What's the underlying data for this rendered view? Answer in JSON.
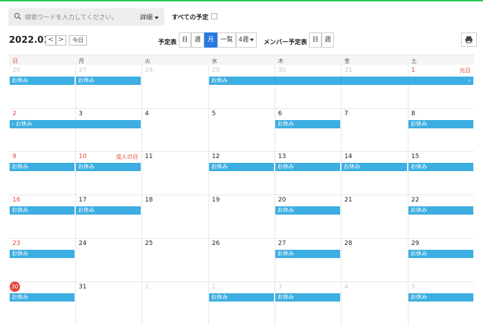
{
  "search": {
    "placeholder": "検索ワードを入力してください。",
    "detail_label": "詳細"
  },
  "all_schedules_label": "すべての予定",
  "toolbar": {
    "year_month": "2022.01",
    "prev": "<",
    "next": ">",
    "today_label": "今日",
    "schedule_label": "予定表",
    "views": [
      "日",
      "週",
      "月",
      "一覧",
      "4週"
    ],
    "active_view": "月",
    "member_label": "メンバー予定表",
    "member_views": [
      "日",
      "週"
    ],
    "print_icon": "printer-icon"
  },
  "weekdays": [
    "日",
    "月",
    "火",
    "水",
    "木",
    "金",
    "土"
  ],
  "weeks": [
    [
      {
        "d": "26",
        "o": true
      },
      {
        "d": "27",
        "o": true
      },
      {
        "d": "28",
        "o": true
      },
      {
        "d": "29",
        "o": true
      },
      {
        "d": "30",
        "o": true
      },
      {
        "d": "31",
        "o": true
      },
      {
        "d": "1",
        "o": false,
        "h": "元日"
      }
    ],
    [
      {
        "d": "2"
      },
      {
        "d": "3"
      },
      {
        "d": "4"
      },
      {
        "d": "5"
      },
      {
        "d": "6"
      },
      {
        "d": "7"
      },
      {
        "d": "8"
      }
    ],
    [
      {
        "d": "9"
      },
      {
        "d": "10",
        "h": "成人の日"
      },
      {
        "d": "11"
      },
      {
        "d": "12"
      },
      {
        "d": "13"
      },
      {
        "d": "14"
      },
      {
        "d": "15"
      }
    ],
    [
      {
        "d": "16"
      },
      {
        "d": "17"
      },
      {
        "d": "18"
      },
      {
        "d": "19"
      },
      {
        "d": "20"
      },
      {
        "d": "21"
      },
      {
        "d": "22"
      }
    ],
    [
      {
        "d": "23"
      },
      {
        "d": "24"
      },
      {
        "d": "25"
      },
      {
        "d": "26"
      },
      {
        "d": "27"
      },
      {
        "d": "28"
      },
      {
        "d": "29"
      }
    ],
    [
      {
        "d": "30",
        "today": true
      },
      {
        "d": "31"
      },
      {
        "d": "1",
        "o": true
      },
      {
        "d": "2",
        "o": true
      },
      {
        "d": "3",
        "o": true
      },
      {
        "d": "4",
        "o": true
      },
      {
        "d": "5",
        "o": true
      }
    ]
  ],
  "events": [
    {
      "w": 0,
      "s": 0,
      "e": 0,
      "t": "お休み"
    },
    {
      "w": 0,
      "s": 1,
      "e": 1,
      "t": "お休み"
    },
    {
      "w": 0,
      "s": 3,
      "e": 6,
      "t": "お休み",
      "cont_right": true
    },
    {
      "w": 1,
      "s": 0,
      "e": 1,
      "t": "お休み",
      "cont_left": true
    },
    {
      "w": 1,
      "s": 4,
      "e": 4,
      "t": "お休み"
    },
    {
      "w": 1,
      "s": 6,
      "e": 6,
      "t": "お休み"
    },
    {
      "w": 2,
      "s": 0,
      "e": 0,
      "t": "お休み"
    },
    {
      "w": 2,
      "s": 1,
      "e": 1,
      "t": "お休み"
    },
    {
      "w": 2,
      "s": 3,
      "e": 3,
      "t": "お休み"
    },
    {
      "w": 2,
      "s": 4,
      "e": 4,
      "t": "お休み"
    },
    {
      "w": 2,
      "s": 5,
      "e": 5,
      "t": "お休み"
    },
    {
      "w": 2,
      "s": 6,
      "e": 6,
      "t": "お休み"
    },
    {
      "w": 3,
      "s": 0,
      "e": 0,
      "t": "お休み"
    },
    {
      "w": 3,
      "s": 1,
      "e": 1,
      "t": "お休み"
    },
    {
      "w": 3,
      "s": 4,
      "e": 4,
      "t": "お休み"
    },
    {
      "w": 3,
      "s": 6,
      "e": 6,
      "t": "お休み"
    },
    {
      "w": 4,
      "s": 0,
      "e": 0,
      "t": "お休み"
    },
    {
      "w": 4,
      "s": 4,
      "e": 4,
      "t": "お休み"
    },
    {
      "w": 4,
      "s": 6,
      "e": 6,
      "t": "お休み"
    },
    {
      "w": 5,
      "s": 0,
      "e": 0,
      "t": "お休み"
    },
    {
      "w": 5,
      "s": 3,
      "e": 3,
      "t": "お休み"
    },
    {
      "w": 5,
      "s": 4,
      "e": 4,
      "t": "お休み"
    },
    {
      "w": 5,
      "s": 6,
      "e": 6,
      "t": "お休み"
    }
  ],
  "colors": {
    "event": "#3daee1",
    "accent": "#2a78e3",
    "sunday": "#e8463c",
    "topline": "#1ec755"
  }
}
